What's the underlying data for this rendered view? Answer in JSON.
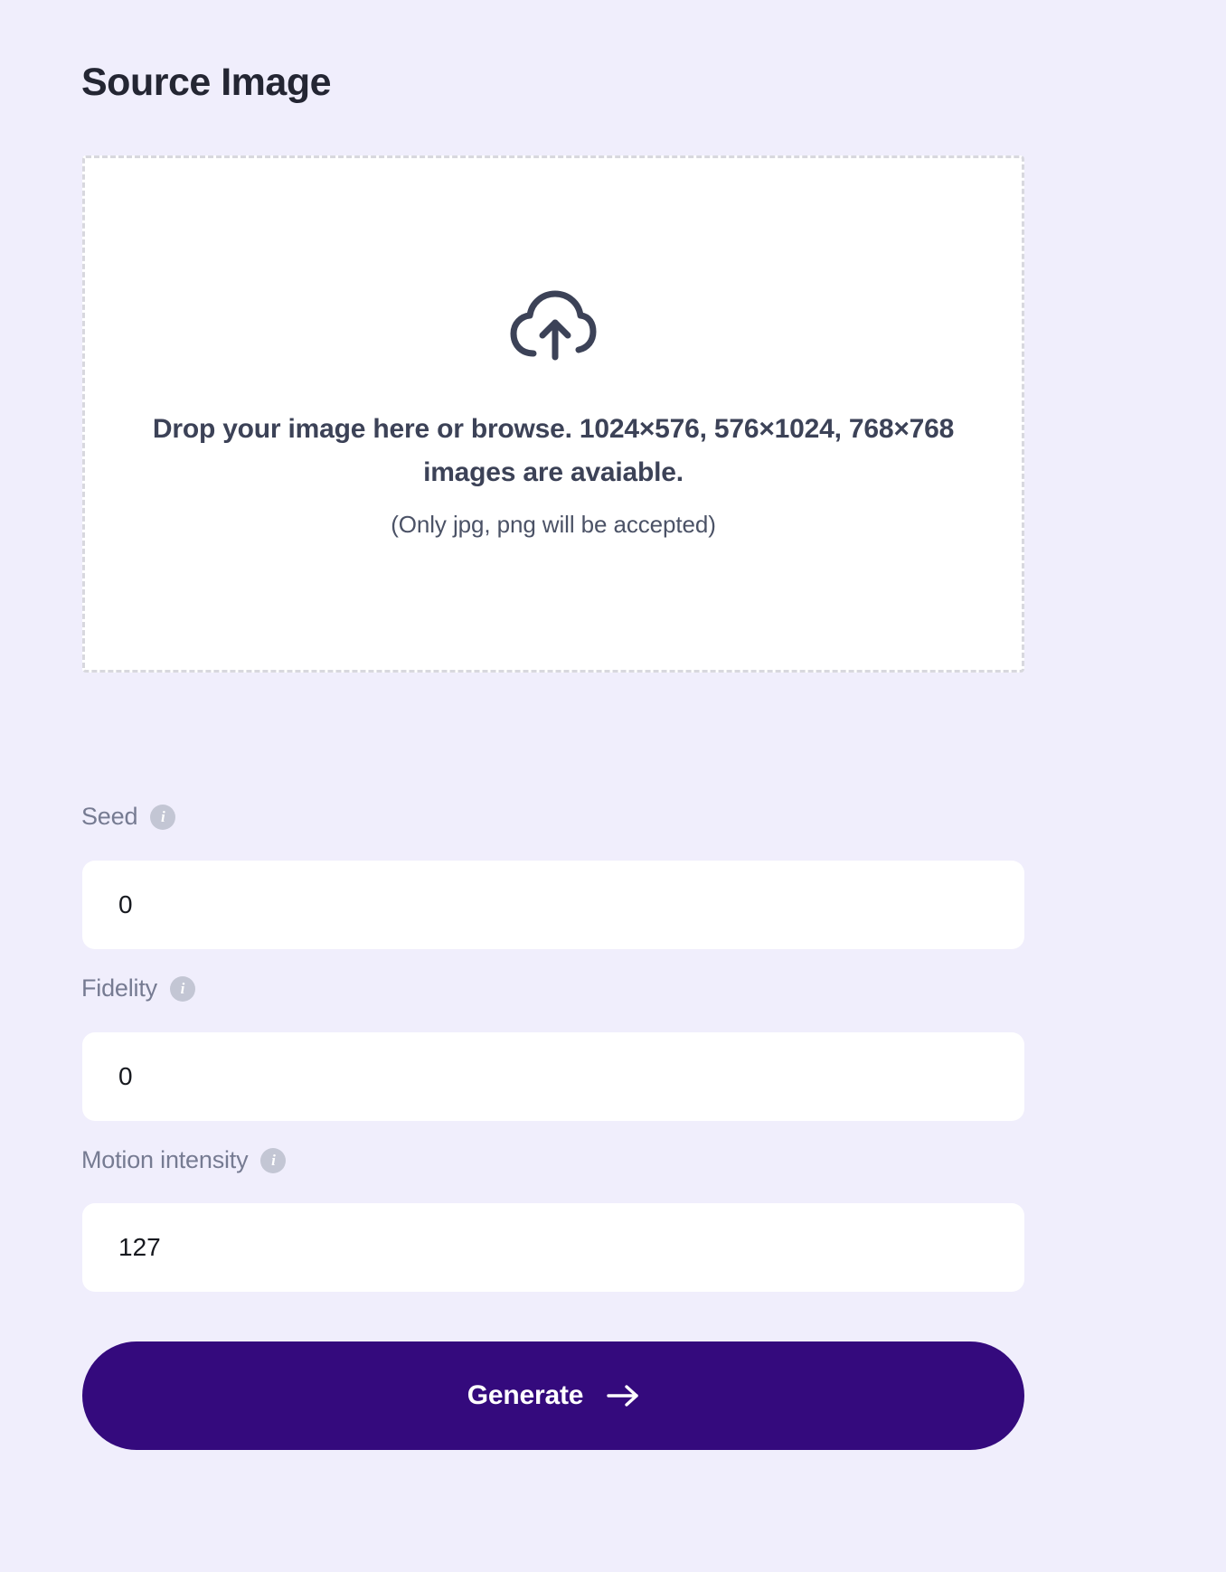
{
  "panel": {
    "title": "Source Image"
  },
  "dropzone": {
    "icon": "cloud-upload-icon",
    "main_text": "Drop your image here or browse. 1024×576, 576×1024, 768×768 images are avaiable.",
    "sub_text": "(Only jpg, png will be accepted)"
  },
  "fields": [
    {
      "label": "Seed",
      "info_icon": "info-icon",
      "info_glyph": "i",
      "value": "0",
      "placeholder": "0"
    },
    {
      "label": "Fidelity",
      "info_icon": "info-icon",
      "info_glyph": "i",
      "value": "0",
      "placeholder": "0"
    },
    {
      "label": "Motion intensity",
      "info_icon": "info-icon",
      "info_glyph": "i",
      "value": "127",
      "placeholder": "127"
    }
  ],
  "actions": {
    "generate_label": "Generate",
    "generate_icon": "arrow-right-icon"
  },
  "colors": {
    "page_background": "#f0eefc",
    "dropzone_background": "#ffffff",
    "dropzone_border": "#d8d8de",
    "title_text": "#242633",
    "label_text": "#767b92",
    "input_background": "#ffffff",
    "input_text": "#17191f",
    "info_icon_background": "#c3c6d4",
    "accent_button": "#340a7d",
    "button_text": "#ffffff"
  }
}
